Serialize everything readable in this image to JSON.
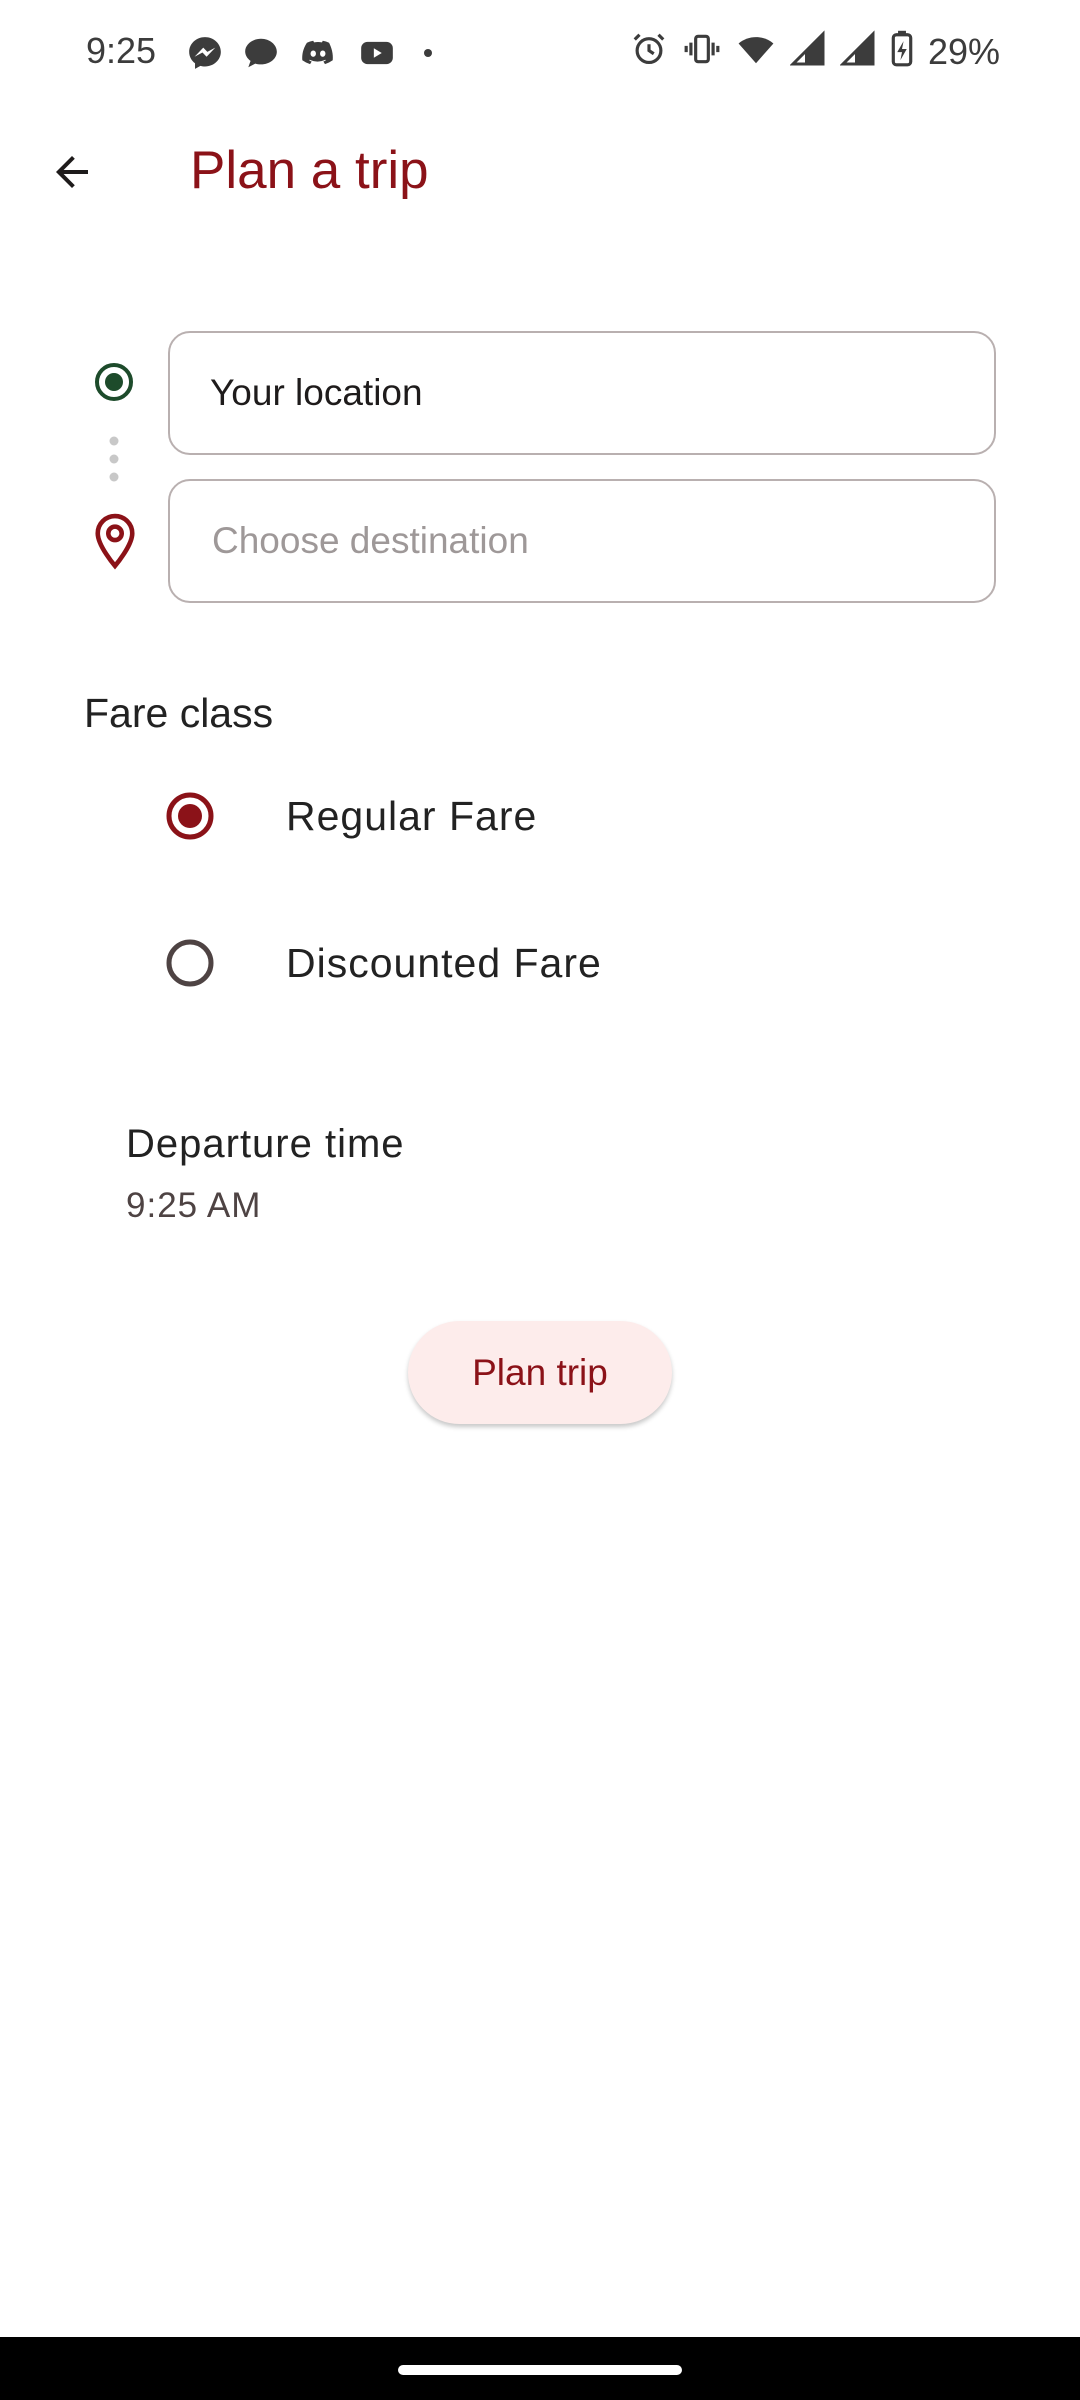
{
  "status_bar": {
    "time": "9:25",
    "battery_percent": "29%",
    "left_icons": [
      "messenger-icon",
      "chat-bubble-icon",
      "discord-icon",
      "youtube-icon",
      "dot-icon"
    ],
    "right_icons": [
      "alarm-icon",
      "vibrate-icon",
      "wifi-icon",
      "signal-icon",
      "signal-icon",
      "battery-charging-icon"
    ]
  },
  "app_bar": {
    "title": "Plan a trip",
    "back_icon": "arrow-back-icon"
  },
  "trip": {
    "origin": {
      "value": "Your location",
      "icon": "radio-target-icon"
    },
    "destination": {
      "placeholder": "Choose destination",
      "icon": "location-pin-icon"
    }
  },
  "fare_class": {
    "title": "Fare class",
    "options": [
      {
        "label": "Regular Fare",
        "selected": true
      },
      {
        "label": "Discounted Fare",
        "selected": false
      }
    ]
  },
  "departure": {
    "label": "Departure time",
    "value": "9:25 AM"
  },
  "actions": {
    "plan_trip_label": "Plan trip"
  },
  "colors": {
    "accent": "#8b1218",
    "origin_green": "#1d4b2b",
    "button_bg": "#fdeceb",
    "field_border": "#b9b0b0"
  }
}
